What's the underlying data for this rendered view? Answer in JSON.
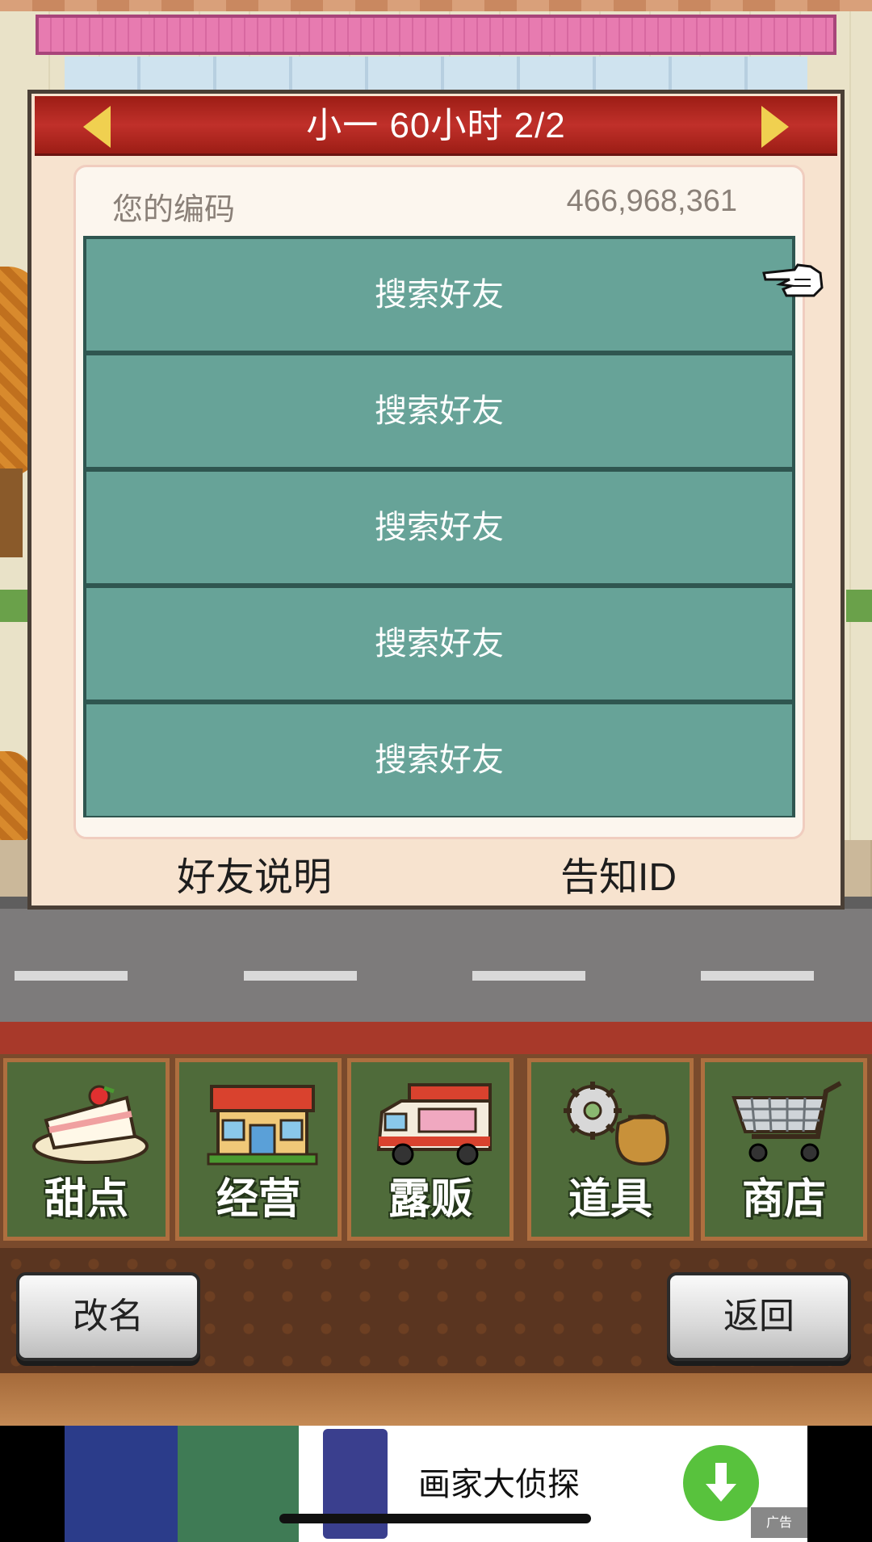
{
  "dialog": {
    "title": "小一  60小时 2/2",
    "code_label": "您的编码",
    "code_value": "466,968,361",
    "slots": [
      "搜索好友",
      "搜索好友",
      "搜索好友",
      "搜索好友",
      "搜索好友"
    ],
    "help_label": "好友说明",
    "notify_label": "告知ID"
  },
  "menu": {
    "items": [
      {
        "label": "甜点",
        "icon": "cake-icon"
      },
      {
        "label": "经营",
        "icon": "storefront-icon"
      },
      {
        "label": "露贩",
        "icon": "food-truck-icon"
      },
      {
        "label": "道具",
        "icon": "gear-and-sack-icon"
      },
      {
        "label": "商店",
        "icon": "shopping-cart-icon"
      }
    ]
  },
  "buttons": {
    "rename": "改名",
    "back": "返回"
  },
  "ad": {
    "title": "画家大侦探",
    "badge": "广告"
  },
  "colors": {
    "header_red": "#c0302a",
    "slot_teal": "#67a398",
    "menu_green": "#4f6b3a",
    "arrow_yellow": "#f0d050"
  }
}
